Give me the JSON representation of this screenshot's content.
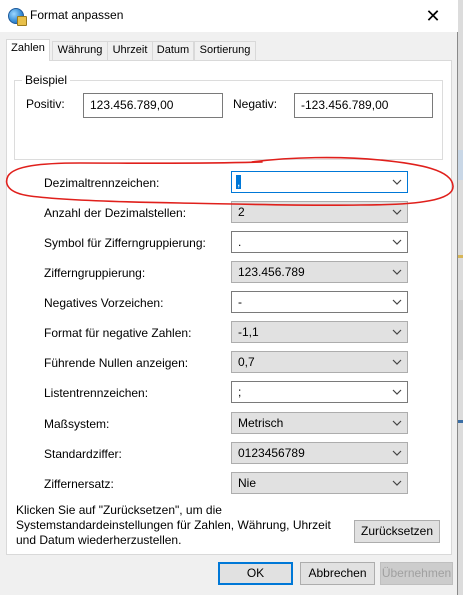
{
  "window": {
    "title": "Format anpassen",
    "title_icon": "globe-settings-icon",
    "close_glyph": "✕"
  },
  "tabs": [
    {
      "label": "Zahlen",
      "active": true
    },
    {
      "label": "Währung",
      "active": false
    },
    {
      "label": "Uhrzeit",
      "active": false
    },
    {
      "label": "Datum",
      "active": false
    },
    {
      "label": "Sortierung",
      "active": false
    }
  ],
  "example": {
    "legend": "Beispiel",
    "positive_label": "Positiv:",
    "positive_value": "123.456.789,00",
    "negative_label": "Negativ:",
    "negative_value": "-123.456.789,00"
  },
  "settings": [
    {
      "label": "Dezimaltrennzeichen:",
      "value": ",",
      "editable": true,
      "focused": true
    },
    {
      "label": "Anzahl der Dezimalstellen:",
      "value": "2",
      "editable": false
    },
    {
      "label": "Symbol für Zifferngruppierung:",
      "value": ".",
      "editable": true
    },
    {
      "label": "Zifferngruppierung:",
      "value": "123.456.789",
      "editable": false
    },
    {
      "label": "Negatives Vorzeichen:",
      "value": "-",
      "editable": true
    },
    {
      "label": "Format für negative Zahlen:",
      "value": "-1,1",
      "editable": false
    },
    {
      "label": "Führende Nullen anzeigen:",
      "value": "0,7",
      "editable": false
    },
    {
      "label": "Listentrennzeichen:",
      "value": ";",
      "editable": true
    },
    {
      "label": "Maßsystem:",
      "value": "Metrisch",
      "editable": false
    },
    {
      "label": "Standardziffer:",
      "value": "0123456789",
      "editable": false
    },
    {
      "label": "Ziffernersatz:",
      "value": "Nie",
      "editable": false
    }
  ],
  "info": {
    "line1": "Klicken Sie auf \"Zurücksetzen\", um die",
    "line2": "Systemstandardeinstellungen für Zahlen, Währung, Uhrzeit",
    "line3": "und Datum wiederherzustellen."
  },
  "buttons": {
    "reset": "Zurücksetzen",
    "ok": "OK",
    "cancel": "Abbrechen",
    "apply": "Übernehmen"
  },
  "colors": {
    "accent": "#0078d7",
    "annotation": "#e0201c"
  }
}
